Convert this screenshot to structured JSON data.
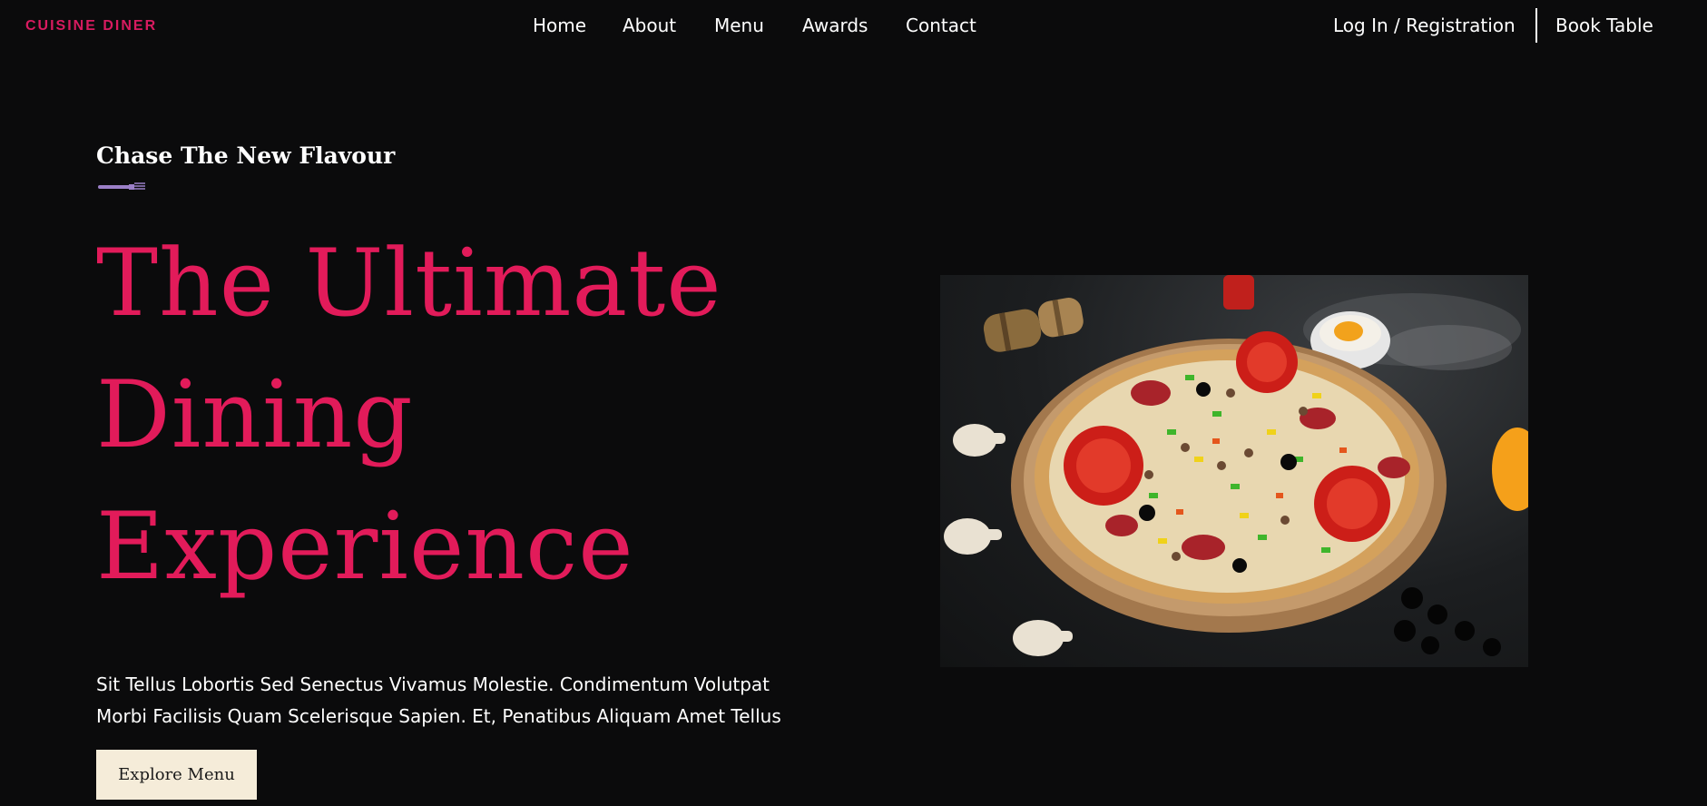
{
  "brand": {
    "logo_text": "CUISINE DINER",
    "accent_color": "#e21b5a"
  },
  "nav": {
    "items": [
      {
        "label": "Home"
      },
      {
        "label": "About"
      },
      {
        "label": "Menu"
      },
      {
        "label": "Awards"
      },
      {
        "label": "Contact"
      }
    ],
    "login_label": "Log In / Registration",
    "book_label": "Book Table"
  },
  "hero": {
    "tagline": "Chase The New Flavour",
    "tagline_icon": "fork-icon",
    "headline_lines": [
      "The Ultimate",
      "Dining",
      "Experience"
    ],
    "description_lines": [
      "Sit Tellus Lobortis Sed Senectus Vivamus Molestie. Condimentum Volutpat",
      "Morbi Facilisis Quam Scelerisque Sapien. Et, Penatibus Aliquam Amet Tellus"
    ],
    "cta_label": "Explore Menu",
    "image_subject": "pizza"
  }
}
